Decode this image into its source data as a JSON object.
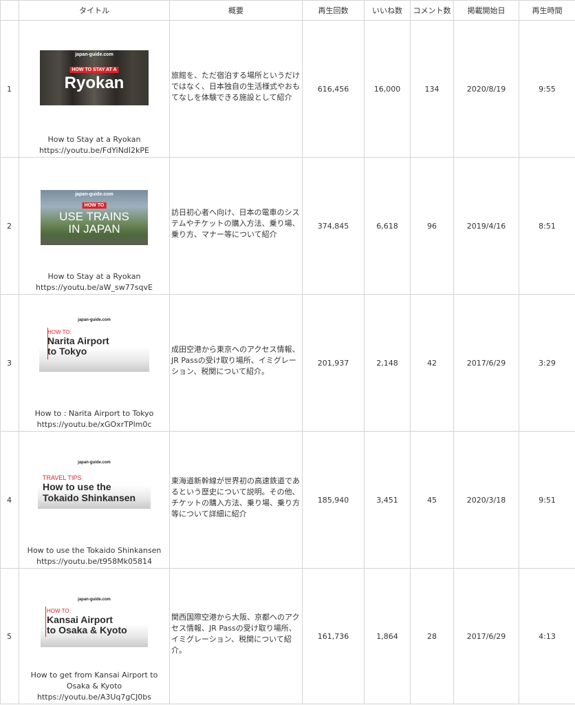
{
  "table": {
    "headers": {
      "index": "",
      "title": "タイトル",
      "summary": "概要",
      "views": "再生回数",
      "likes": "いいね数",
      "comments": "コメント数",
      "published": "掲載開始日",
      "duration": "再生時間"
    },
    "rows": [
      {
        "index": "1",
        "thumbnail": {
          "site": "japan-guide.com",
          "tag": "HOW TO STAY AT A",
          "headline": "Ryokan"
        },
        "title": "How to Stay at a Ryokan",
        "url": "https://youtu.be/FdYiNdI2kPE",
        "summary": "旅館を、ただ宿泊する場所というだけではなく、日本独自の生活様式やおもてなしを体験できる施設として紹介",
        "views": "616,456",
        "likes": "16,000",
        "comments": "134",
        "published": "2020/8/19",
        "duration": "9:55"
      },
      {
        "index": "2",
        "thumbnail": {
          "site": "japan-guide.com",
          "tag": "HOW TO",
          "headline_line1": "USE TRAINS",
          "headline_line2": "IN JAPAN"
        },
        "title": "How to Stay at a Ryokan",
        "url": "https://youtu.be/aW_sw77sqvE",
        "summary": "訪日初心者へ向け、日本の電車のシステムやチケットの購入方法、乗り場、乗り方、マナー等について紹介",
        "views": "374,845",
        "likes": "6,618",
        "comments": "96",
        "published": "2019/4/16",
        "duration": "8:51"
      },
      {
        "index": "3",
        "thumbnail": {
          "site": "japan-guide.com",
          "tag": "HOW TO:",
          "headline_line1": "Narita Airport",
          "headline_line2": "to Tokyo"
        },
        "title": "How to : Narita Airport to Tokyo",
        "url": "https://youtu.be/xGOxrTPlm0c",
        "summary": "成田空港から東京へのアクセス情報、JR Passの受け取り場所、イミグレーション、税関について紹介。",
        "views": "201,937",
        "likes": "2,148",
        "comments": "42",
        "published": "2017/6/29",
        "duration": "3:29"
      },
      {
        "index": "4",
        "thumbnail": {
          "site": "japan-guide.com",
          "tag": "TRAVEL TIPS",
          "headline_line1": "How to use the",
          "headline_line2": "Tokaido Shinkansen"
        },
        "title": "How to use the Tokaido Shinkansen",
        "url": "https://youtu.be/t958Mk05814",
        "summary": "東海道新幹線が世界初の高速鉄道であるという歴史について説明。その他、チケットの購入方法、乗り場、乗り方等について詳細に紹介",
        "views": "185,940",
        "likes": "3,451",
        "comments": "45",
        "published": "2020/3/18",
        "duration": "9:51"
      },
      {
        "index": "5",
        "thumbnail": {
          "site": "japan-guide.com",
          "tag": "HOW TO:",
          "headline_line1": "Kansai Airport",
          "headline_line2": "to Osaka & Kyoto"
        },
        "title_line1": "How to get from Kansai Airport to",
        "title_line2": "Osaka & Kyoto",
        "url": "https://youtu.be/A3Uq7gCJ0bs",
        "summary": "関西国際空港から大阪、京都へのアクセス情報、JR Passの受け取り場所、イミグレーション、税関について紹介。",
        "views": "161,736",
        "likes": "1,864",
        "comments": "28",
        "published": "2017/6/29",
        "duration": "4:13"
      }
    ]
  }
}
